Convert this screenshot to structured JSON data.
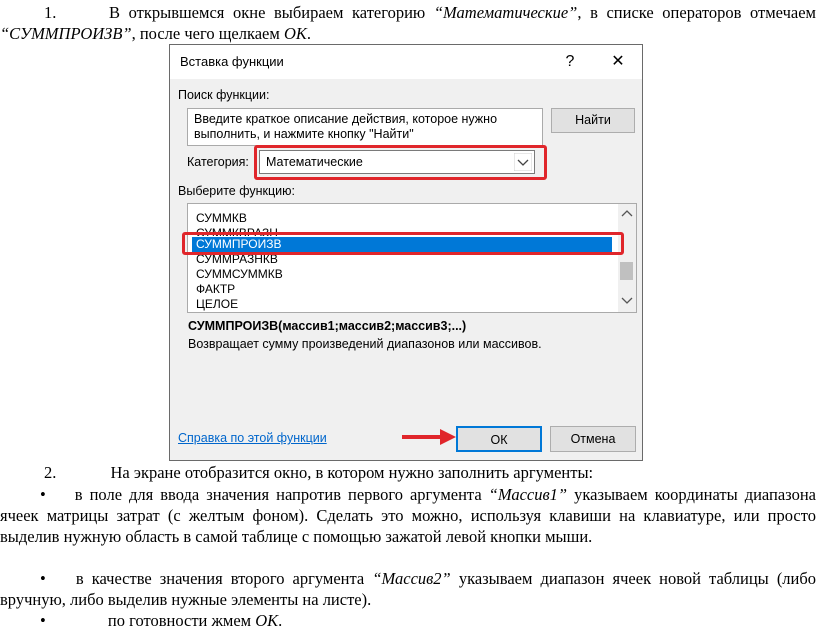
{
  "doc": {
    "p1_num": "1.",
    "p1_a": "В открывшемся окне выбираем категорию ",
    "p1_cat": "“Математические”",
    "p1_b": ", в списке операторов отмечаем ",
    "p1_func": "“СУММПРОИЗВ”",
    "p1_c": ", после чего щелкаем ",
    "p1_ok": "ОК",
    "p1_d": ".",
    "p2_num": "2.",
    "p2": "На экране отобразится окно, в котором нужно заполнить аргументы:",
    "b1_a": "в поле для ввода значения напротив первого аргумента ",
    "b1_arg": "“Массив1”",
    "b1_b": " указываем координаты диапазона ячеек матрицы затрат (с желтым фоном). Сделать это можно, используя клавиши на клавиатуре, или просто выделив нужную область в самой таблице с помощью зажатой левой кнопки мыши.",
    "b2_a": "в качестве значения второго аргумента ",
    "b2_arg": "“Массив2”",
    "b2_b": " указываем диапазон ячеек новой таблицы (либо вручную, либо выделив нужные элементы на листе).",
    "b3_a": "по готовности жмем ",
    "b3_ok": "ОК",
    "b3_b": ".",
    "bullet": "•"
  },
  "dialog": {
    "title": "Вставка функции",
    "help_glyph": "?",
    "close_glyph": "✕",
    "search_label": "Поиск функции:",
    "search_text": "Введите краткое описание действия, которое нужно выполнить, и нажмите кнопку \"Найти\"",
    "find_button": "Найти",
    "category_label": "Категория:",
    "category_value": "Математические",
    "select_label": "Выберите функцию:",
    "functions": [
      "СУММКВ",
      "СУММКВРАЗН",
      "СУММПРОИЗВ",
      "СУММРАЗНКВ",
      "СУММСУММКВ",
      "ФАКТР",
      "ЦЕЛОЕ"
    ],
    "selected_index": 2,
    "signature": "СУММПРОИЗВ(массив1;массив2;массив3;...)",
    "description": "Возвращает сумму произведений диапазонов или массивов.",
    "help_link": "Справка по этой функции",
    "ok_button": "ОК",
    "cancel_button": "Отмена"
  },
  "colors": {
    "highlight_red": "#e0262b",
    "selection_blue": "#0078d7",
    "link_blue": "#0066cc"
  }
}
